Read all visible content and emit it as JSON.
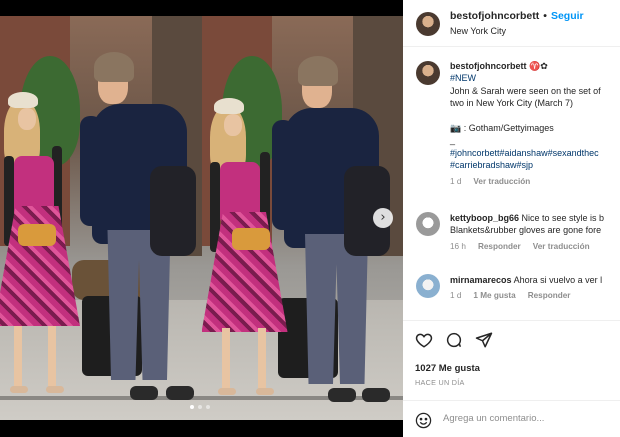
{
  "post": {
    "username": "bestofjohncorbett",
    "follow_label": "Seguir",
    "location": "New York City"
  },
  "caption": {
    "username": "bestofjohncorbett",
    "username_suffix": " ♈✿",
    "lines": [
      "#NEW",
      "John & Sarah were seen on the set of",
      "two in New York City (March 7)",
      "",
      "📷 : Gotham/Gettyimages",
      "_",
      "#johncorbett#aidanshaw#sexandthec",
      "#carriebradshaw#sjp"
    ],
    "time": "1 d",
    "translate": "Ver traducción"
  },
  "comments": [
    {
      "username": "kettyboop_bg66",
      "line1": "Nice to see style is b",
      "line2": "Blankets&rubber gloves are gone fore",
      "time": "16 h",
      "reply": "Responder",
      "translate": "Ver traducción"
    },
    {
      "username": "mirnamarecos",
      "line1": "Ahora si vuelvo a ver l",
      "time": "1 d",
      "likes": "1 Me gusta",
      "reply": "Responder"
    }
  ],
  "actions": {
    "likes": "1027 Me gusta",
    "time": "HACE UN DÍA"
  },
  "add_comment": {
    "placeholder": "Agrega un comentario..."
  },
  "media": {
    "next_icon": "chevron-right-icon",
    "slide_count": 3,
    "active_slide": 0
  },
  "colors": {
    "link": "#00376b",
    "follow": "#0095f6",
    "muted": "#8e8e8e"
  }
}
